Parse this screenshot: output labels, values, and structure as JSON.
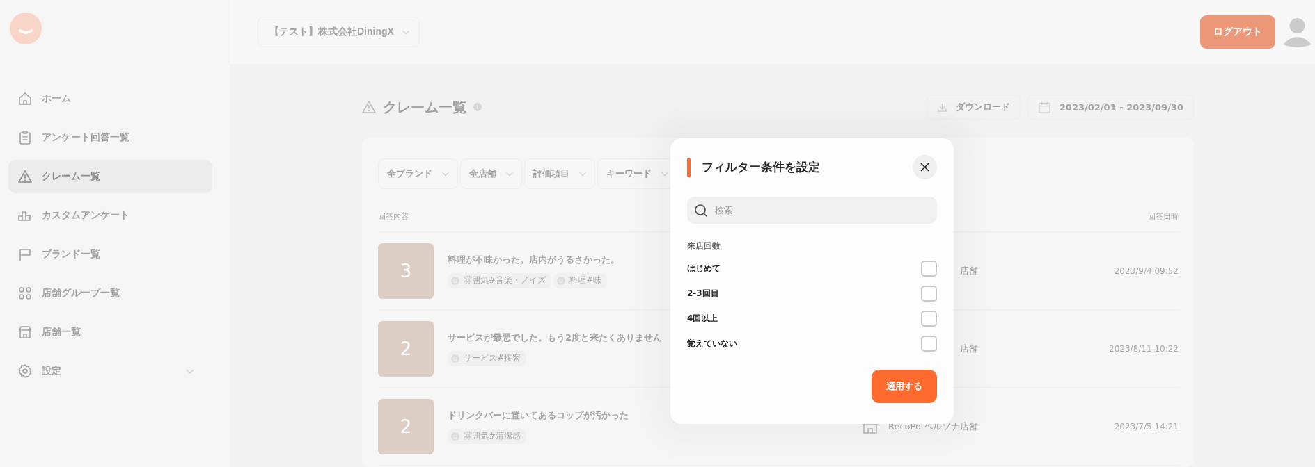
{
  "sidebar": {
    "items": [
      {
        "label": "ホーム",
        "selected": false
      },
      {
        "label": "アンケート回答一覧",
        "selected": false
      },
      {
        "label": "クレーム一覧",
        "selected": true
      },
      {
        "label": "カスタムアンケート",
        "selected": false
      },
      {
        "label": "ブランド一覧",
        "selected": false
      },
      {
        "label": "店舗グループ一覧",
        "selected": false
      },
      {
        "label": "店舗一覧",
        "selected": false
      },
      {
        "label": "設定",
        "selected": false,
        "expanded": false
      }
    ]
  },
  "header": {
    "company_selector": "【テスト】株式会社DiningX",
    "logout_button": "ログアウト"
  },
  "page": {
    "title": "クレーム一覧",
    "download_button": "ダウンロード",
    "date_range": "2023/02/01 - 2023/09/30"
  },
  "filters": [
    "全ブランド",
    "全店舗",
    "評価項目",
    "キーワード"
  ],
  "table": {
    "columns": [
      "回答内容",
      "回答日時"
    ],
    "rows": [
      {
        "score": "3",
        "text": "料理が不味かった。店内がうるさかった。",
        "tags": [
          "雰囲気#音楽・ノイズ",
          "料理#味"
        ],
        "store": "店舗",
        "store_icon": false,
        "date": "2023/9/4 09:52"
      },
      {
        "score": "2",
        "text": "サービスが最悪でした。もう2度と来たくありません",
        "tags": [
          "サービス#接客"
        ],
        "store": "店舗",
        "store_icon": false,
        "date": "2023/8/11 10:22"
      },
      {
        "score": "2",
        "text": "ドリンクバーに置いてあるコップが汚かった",
        "tags": [
          "雰囲気#清潔感"
        ],
        "store": "RecoPo ペルソナ店舗",
        "store_icon": true,
        "date": "2023/7/5 14:21"
      }
    ]
  },
  "modal": {
    "title": "フィルター条件を設定",
    "search_placeholder": "検索",
    "section": "来店回数",
    "options": [
      {
        "label": "はじめて",
        "checked": false
      },
      {
        "label": "2-3回目",
        "checked": false
      },
      {
        "label": "4回以上",
        "checked": false
      },
      {
        "label": "覚えていない",
        "checked": false
      }
    ],
    "apply_button": "適用する"
  }
}
